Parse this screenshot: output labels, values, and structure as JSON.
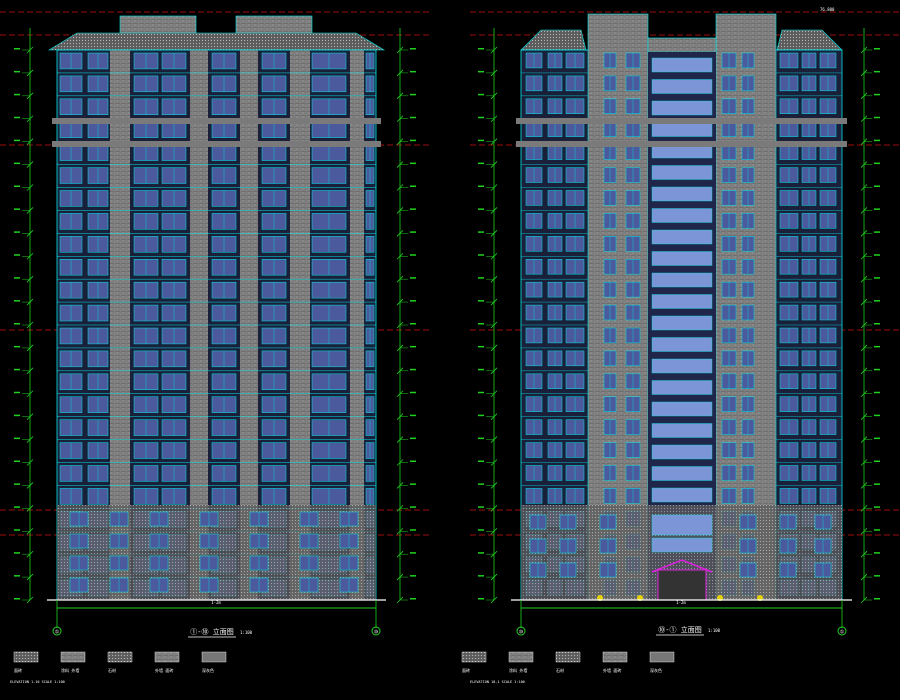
{
  "drawing": {
    "background": "#000000",
    "colors": {
      "outline": "#00e5e5",
      "glass": "#4a5a9c",
      "glass_core": "#7b95d6",
      "brick": "#8a8a8a",
      "band": "#7a7a7a",
      "dim": "#1fd21f",
      "level": "#d01010",
      "text": "#ffffff",
      "accent": "#e020e0",
      "lamp": "#e6d200"
    },
    "floors": 24,
    "elevations": [
      {
        "id": "left",
        "title": "①-⑩ 立面图",
        "scale": "1:100",
        "axis_start": "①",
        "axis_end": "⑩",
        "axis_dimension": "1-2m",
        "notes": "ELEVATION 1-10 SCALE 1:100",
        "legend": [
          {
            "swatch": "dotted",
            "label": "面砖"
          },
          {
            "swatch": "brick",
            "label": "涂料 外墙"
          },
          {
            "swatch": "dotted",
            "label": "石材"
          },
          {
            "swatch": "brick",
            "label": "外墙 面砖"
          },
          {
            "swatch": "solid",
            "label": "深灰色"
          }
        ]
      },
      {
        "id": "right",
        "title": "⑩-① 立面图",
        "scale": "1:100",
        "axis_start": "⑩",
        "axis_end": "①",
        "axis_dimension": "1-2m",
        "notes": "ELEVATION 10-1 SCALE 1:100",
        "top_marker": "76.800",
        "legend": [
          {
            "swatch": "dotted",
            "label": "面砖"
          },
          {
            "swatch": "brick",
            "label": "涂料 外墙"
          },
          {
            "swatch": "dotted",
            "label": "石材"
          },
          {
            "swatch": "brick",
            "label": "外墙 面砖"
          },
          {
            "swatch": "solid",
            "label": "深灰色"
          }
        ]
      }
    ]
  }
}
